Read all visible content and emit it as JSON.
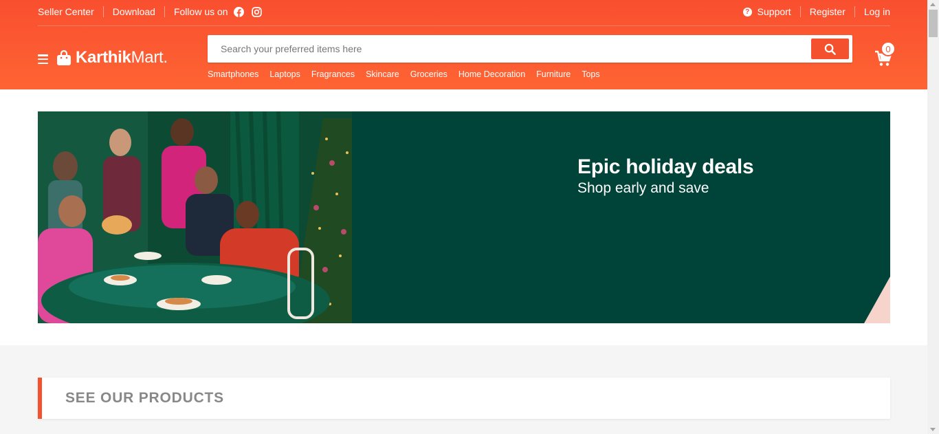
{
  "topbar": {
    "seller_center": "Seller Center",
    "download": "Download",
    "follow_us": "Follow us on",
    "social_icons": [
      "facebook-icon",
      "instagram-icon"
    ],
    "support": "Support",
    "register": "Register",
    "login": "Log in"
  },
  "brand": {
    "bold": "Karthik",
    "regular": "Mart."
  },
  "search": {
    "placeholder": "Search your preferred items here",
    "value": ""
  },
  "categories": [
    "Smartphones",
    "Laptops",
    "Fragrances",
    "Skincare",
    "Groceries",
    "Home Decoration",
    "Furniture",
    "Tops"
  ],
  "cart": {
    "count": "0"
  },
  "banner": {
    "title": "Epic holiday deals",
    "subtitle": "Shop early and save"
  },
  "section": {
    "title": "SEE OUR PRODUCTS"
  },
  "colors": {
    "primary": "#f94f30",
    "banner_bg": "#004439",
    "accent_pink": "#f6d4cc"
  }
}
